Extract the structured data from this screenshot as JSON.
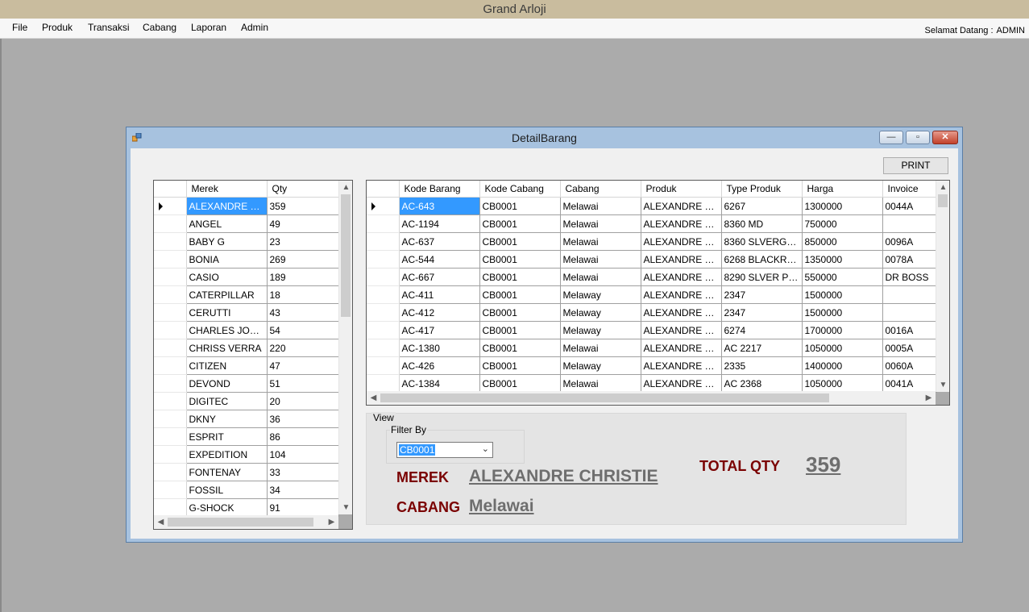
{
  "app": {
    "title": "Grand Arloji"
  },
  "menu": [
    "File",
    "Produk",
    "Transaksi",
    "Cabang",
    "Laporan",
    "Admin"
  ],
  "welcome": {
    "label": "Selamat Datang :",
    "user": "ADMIN"
  },
  "child_window": {
    "title": "DetailBarang",
    "buttons": {
      "minimize": "—",
      "maximize": "▫",
      "close": "✕"
    }
  },
  "print_label": "PRINT",
  "merek_grid": {
    "columns": [
      "Merek",
      "Qty"
    ],
    "rows": [
      [
        "ALEXANDRE CH...",
        "359"
      ],
      [
        "ANGEL",
        "49"
      ],
      [
        "BABY G",
        "23"
      ],
      [
        "BONIA",
        "269"
      ],
      [
        "CASIO",
        "189"
      ],
      [
        "CATERPILLAR",
        "18"
      ],
      [
        "CERUTTI",
        "43"
      ],
      [
        "CHARLES JOUR...",
        "54"
      ],
      [
        "CHRISS VERRA",
        "220"
      ],
      [
        "CITIZEN",
        "47"
      ],
      [
        "DEVOND",
        "51"
      ],
      [
        "DIGITEC",
        "20"
      ],
      [
        "DKNY",
        "36"
      ],
      [
        "ESPRIT",
        "86"
      ],
      [
        "EXPEDITION",
        "104"
      ],
      [
        "FONTENAY",
        "33"
      ],
      [
        "FOSSIL",
        "34"
      ],
      [
        "G-SHOCK",
        "91"
      ]
    ]
  },
  "barang_grid": {
    "columns": [
      "Kode Barang",
      "Kode Cabang",
      "Cabang",
      "Produk",
      "Type Produk",
      "Harga",
      "Invoice"
    ],
    "rows": [
      [
        "AC-643",
        "CB0001",
        "Melawai",
        "ALEXANDRE CH...",
        "6267",
        "1300000",
        "0044A"
      ],
      [
        "AC-1194",
        "CB0001",
        "Melawai",
        "ALEXANDRE CH...",
        "8360 MD",
        "750000",
        ""
      ],
      [
        "AC-637",
        "CB0001",
        "Melawai",
        "ALEXANDRE CH...",
        "8360 SLVERGO...",
        "850000",
        "0096A"
      ],
      [
        "AC-544",
        "CB0001",
        "Melawai",
        "ALEXANDRE CH...",
        "6268 BLACKRG...",
        "1350000",
        "0078A"
      ],
      [
        "AC-667",
        "CB0001",
        "Melawai",
        "ALEXANDRE CH...",
        "8290 SLVER PL...",
        "550000",
        "DR BOSS"
      ],
      [
        "AC-411",
        "CB0001",
        "Melaway",
        "ALEXANDRE CH...",
        "2347",
        "1500000",
        ""
      ],
      [
        "AC-412",
        "CB0001",
        "Melaway",
        "ALEXANDRE CH...",
        "2347",
        "1500000",
        ""
      ],
      [
        "AC-417",
        "CB0001",
        "Melaway",
        "ALEXANDRE CH...",
        "6274",
        "1700000",
        "0016A"
      ],
      [
        "AC-1380",
        "CB0001",
        "Melawai",
        "ALEXANDRE CH...",
        "AC 2217",
        "1050000",
        "0005A"
      ],
      [
        "AC-426",
        "CB0001",
        "Melaway",
        "ALEXANDRE CH...",
        "2335",
        "1400000",
        "0060A"
      ],
      [
        "AC-1384",
        "CB0001",
        "Melawai",
        "ALEXANDRE CH...",
        "AC 2368",
        "1050000",
        "0041A"
      ]
    ]
  },
  "view": {
    "label": "View",
    "filter_label": "Filter By",
    "filter_value": "CB0001",
    "merek_label": "MEREK",
    "merek_value": "ALEXANDRE CHRISTIE",
    "cabang_label": "CABANG",
    "cabang_value": "Melawai",
    "total_label": "TOTAL QTY",
    "total_value": "359"
  },
  "colors": {
    "selection": "#3399ff",
    "label_red": "#7a0000",
    "titlebar": "#c9bc9e"
  }
}
